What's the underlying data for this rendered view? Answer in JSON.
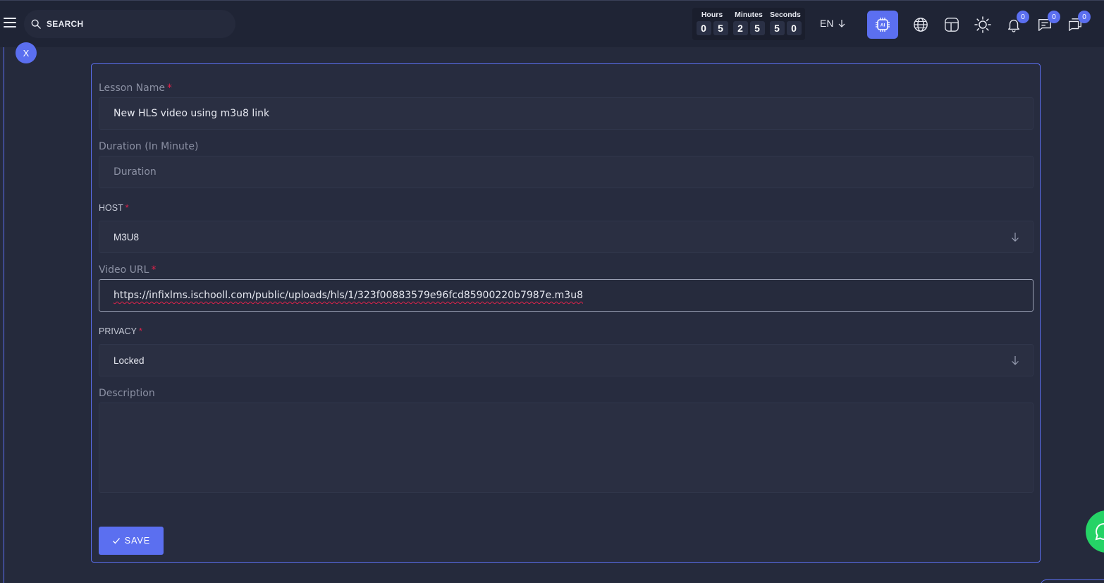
{
  "topbar": {
    "search_placeholder": "SEARCH",
    "timer": {
      "hours_label": "Hours",
      "minutes_label": "Minutes",
      "seconds_label": "Seconds",
      "hours": [
        "0",
        "5"
      ],
      "minutes": [
        "2",
        "5"
      ],
      "seconds": [
        "5",
        "0"
      ]
    },
    "language": "EN",
    "notification_count": "0",
    "message_count": "0",
    "chat_count": "0"
  },
  "close_label": "X",
  "form": {
    "lesson_name_label": "Lesson Name",
    "lesson_name_value": "New HLS video using m3u8 link",
    "duration_label": "Duration (In Minute)",
    "duration_placeholder": "Duration",
    "host_label": "HOST",
    "host_value": "M3U8",
    "video_url_label": "Video URL",
    "video_url_value": "https://infixlms.ischooll.com/public/uploads/hls/1/323f00883579e96fcd85900220b7987e.m3u8",
    "privacy_label": "PRIVACY",
    "privacy_value": "Locked",
    "description_label": "Description",
    "required_mark": "*",
    "save_label": "SAVE"
  },
  "colors": {
    "accent": "#5b6ff0",
    "background": "#252a3c",
    "required": "#e0224a"
  }
}
